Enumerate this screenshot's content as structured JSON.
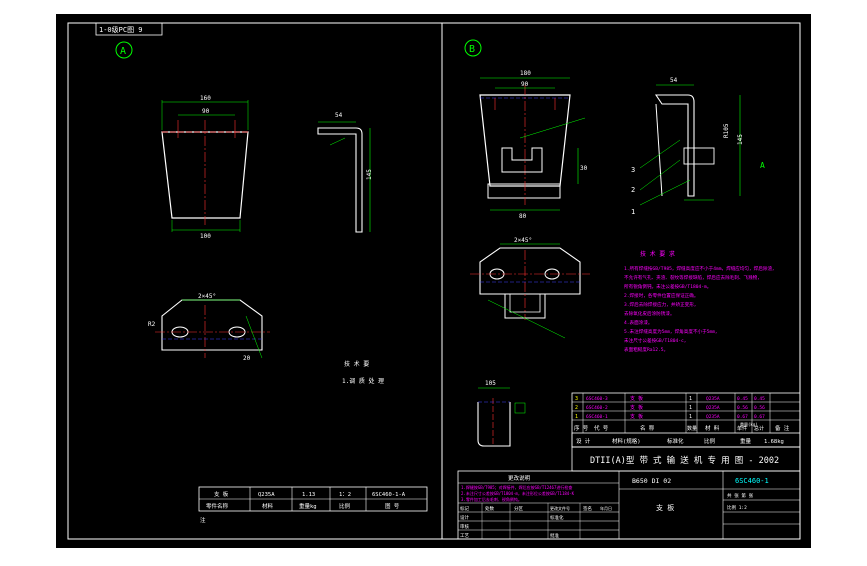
{
  "drawing_id_box": "1-0级PC图 9",
  "view_markers": {
    "left": "A",
    "right": "B"
  },
  "view_a": {
    "dims": {
      "top_width": "160",
      "inner_width": "90",
      "bottom_width": "100",
      "bend_flange": "54",
      "height": "145",
      "hole_angle": "2×45°",
      "hole_dim": "R2",
      "hole_depth": "20"
    },
    "tech_notes": [
      "技 术 要",
      "1.调 质 处 理"
    ]
  },
  "view_b": {
    "dims": {
      "top_width": "180",
      "inner_width": "90",
      "slot_height": "30",
      "bottom_width": "80",
      "side_width": "54",
      "side_height": "145",
      "bend_label": "R105",
      "angle": "2×45°",
      "detail_width": "105",
      "section_label": "A"
    },
    "callouts": [
      "1",
      "2",
      "3"
    ]
  },
  "tech_requirements": {
    "title": "技 术 要 求",
    "lines": [
      "1.所有焊缝按GB/T985，焊缝高度应不小于4mm，焊缝应均匀，焊后除渣，",
      "不允许有气孔、夹渣、裂纹等焊接缺陷，焊后应去除毛刺、飞溅物，",
      "所有锐角倒钝，未注公差按GB/T1804-m。",
      "2.焊接时，各零件位置应保证正确。",
      "3.焊后去除焊接应力，并矫正变形，",
      "去除氧化皮后涂防锈漆。",
      "4.表面涂漆。",
      "5.未注焊缝高度为5mm，焊角高度不小于5mm，",
      "未注尺寸公差按GB/T1804-c，",
      "表面粗糙度Ra12.5。"
    ]
  },
  "small_table": {
    "rows": [
      [
        "支  板",
        "Q235A",
        "1.13",
        "1：2",
        "6SC460-1-A"
      ],
      [
        "零件名称",
        "材料",
        "重量kg",
        "比例",
        "图 号"
      ]
    ],
    "extra": "注"
  },
  "parts_list": {
    "rows": [
      [
        "3",
        "6SC460-3",
        "支 板",
        "1",
        "Q235A",
        "0.45",
        "0.45"
      ],
      [
        "2",
        "6SC460-2",
        "支 板",
        "1",
        "Q235A",
        "0.56",
        "0.56"
      ],
      [
        "1",
        "6SC460-1",
        "支 板",
        "1",
        "Q235A",
        "0.67",
        "0.67"
      ]
    ],
    "header": [
      "序 号",
      "代 号",
      "名 称",
      "数量",
      "材 料",
      "单件",
      "总计",
      "备 注"
    ],
    "weight_header": "重量(kg)",
    "info_row": [
      "设  计",
      "材料(规格)",
      "标准化",
      "比例",
      "重量",
      "1.68kg"
    ]
  },
  "title_block": {
    "project": "DTII(A)型  带 式 输 送 机 专 用 图 - 2002",
    "drawing_title": "B650  DI 02",
    "drawing_number": "6SC460-1",
    "name": "支  板",
    "sheet_label": "共  张  第  张",
    "scale_label": "比例  1:2",
    "sign_rows": [
      [
        "标记",
        "处数",
        "分区",
        "更改文件号",
        "签名",
        "年月日"
      ],
      [
        "设计",
        "",
        "",
        "标准化",
        "",
        ""
      ],
      [
        "审核",
        "",
        "",
        "",
        "",
        ""
      ],
      [
        "工艺",
        "",
        "",
        "批准",
        "",
        ""
      ]
    ],
    "change_note_title": "更改说明",
    "change_notes": [
      "1.焊缝按GB/T985；对焊接件，焊后应按GB/T12467进行检查",
      "2.未注尺寸公差按GB/T1804-m，未注形位公差按GB/T1184-K",
      "3.零件加工后去毛刺、锐角倒钝。"
    ]
  },
  "colors": {
    "sheet": "#000000",
    "outer": "#ffffff",
    "frame": "#ffffff",
    "outline": "#ffffff",
    "dim": "#00ff00",
    "center": "#ff3030",
    "hidden": "#4040ff",
    "text": "#ffffff",
    "note": "#ff00ff",
    "yellow": "#ffff00",
    "accent": "#00ffff"
  }
}
